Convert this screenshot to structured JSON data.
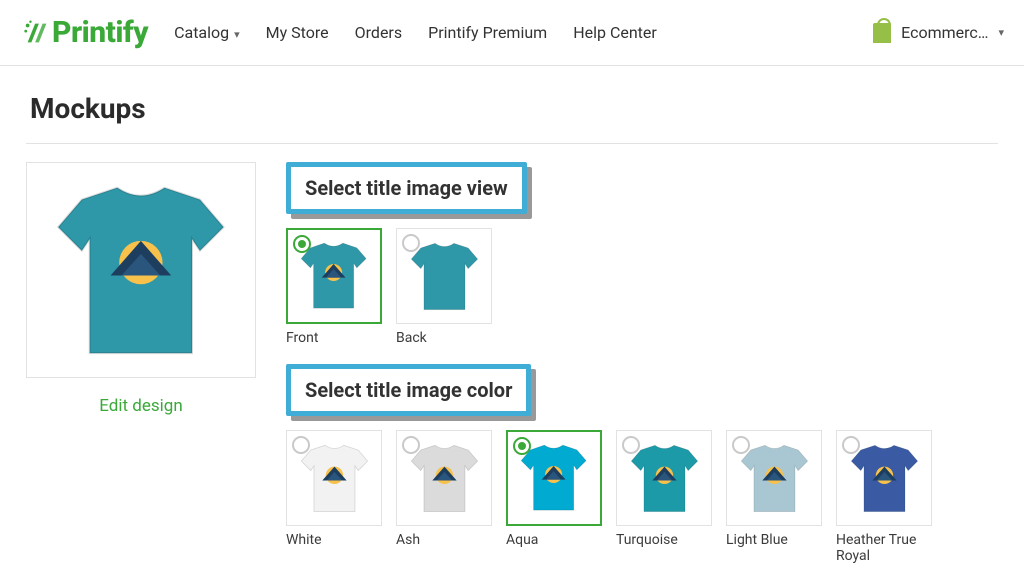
{
  "nav": {
    "brand": "Printify",
    "items": [
      {
        "label": "Catalog",
        "dropdown": true
      },
      {
        "label": "My Store",
        "dropdown": false
      },
      {
        "label": "Orders",
        "dropdown": false
      },
      {
        "label": "Printify Premium",
        "dropdown": false
      },
      {
        "label": "Help Center",
        "dropdown": false
      }
    ],
    "store_label": "Ecommerc…"
  },
  "page": {
    "title": "Mockups",
    "edit_design": "Edit design"
  },
  "view_section": {
    "heading": "Select title image view",
    "options": [
      {
        "label": "Front",
        "selected": true,
        "shirt_color": "#2f98a8",
        "logo": true
      },
      {
        "label": "Back",
        "selected": false,
        "shirt_color": "#2f98a8",
        "logo": false
      }
    ]
  },
  "color_section": {
    "heading": "Select title image color",
    "options": [
      {
        "label": "White",
        "selected": false,
        "shirt_color": "#f2f2f2",
        "logo": true
      },
      {
        "label": "Ash",
        "selected": false,
        "shirt_color": "#dbdbdb",
        "logo": true
      },
      {
        "label": "Aqua",
        "selected": true,
        "shirt_color": "#00aad0",
        "logo": true
      },
      {
        "label": "Turquoise",
        "selected": false,
        "shirt_color": "#1c9aa8",
        "logo": true
      },
      {
        "label": "Light Blue",
        "selected": false,
        "shirt_color": "#a9c7d2",
        "logo": true
      },
      {
        "label": "Heather True Royal",
        "selected": false,
        "shirt_color": "#3a5ba3",
        "logo": true
      }
    ]
  },
  "preview": {
    "shirt_color": "#2f98a8",
    "logo": true
  }
}
